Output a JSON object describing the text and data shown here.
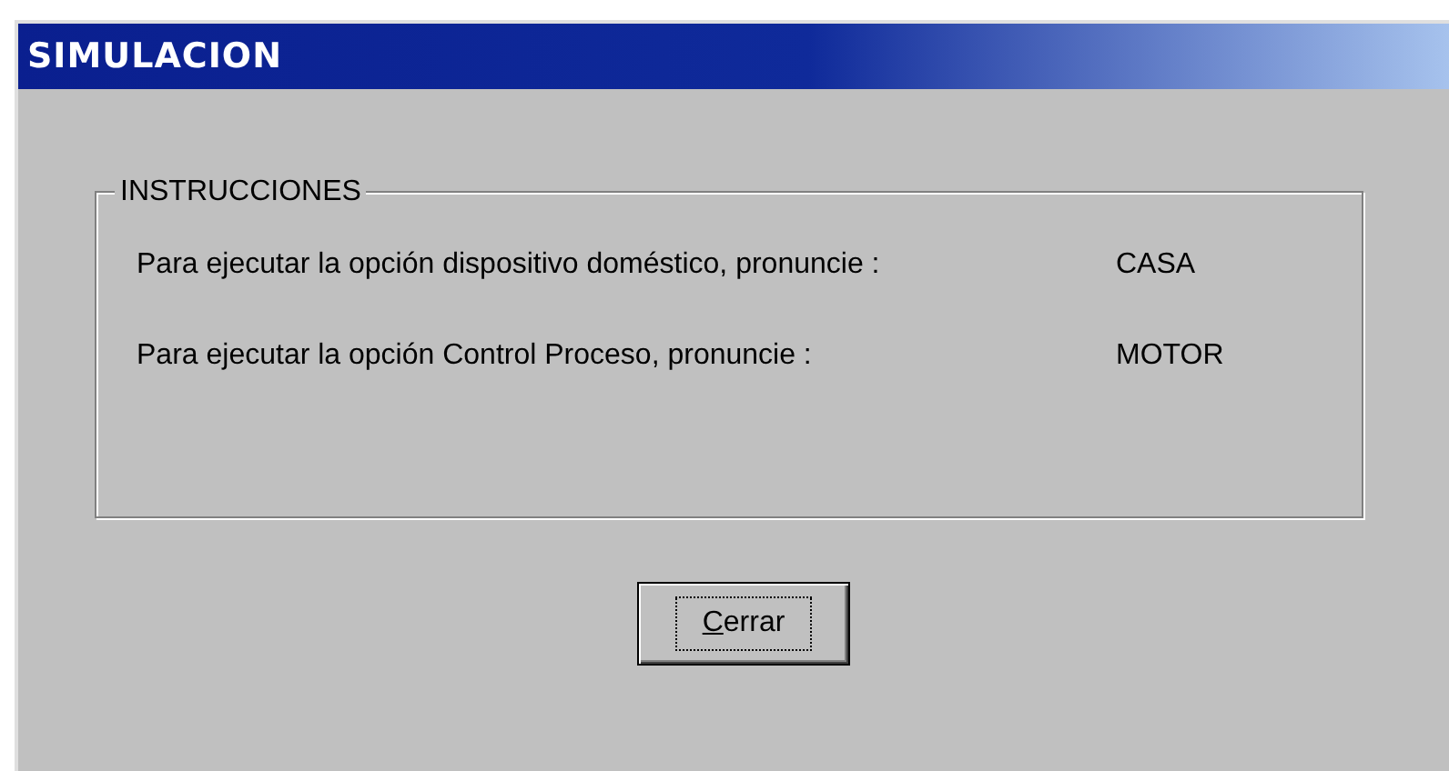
{
  "window": {
    "title": "SIMULACION"
  },
  "group": {
    "title": "INSTRUCCIONES",
    "rows": [
      {
        "text": "Para ejecutar la opción dispositivo doméstico, pronuncie :",
        "command": "CASA"
      },
      {
        "text": "Para ejecutar la opción Control Proceso, pronuncie :",
        "command": "MOTOR"
      }
    ]
  },
  "button": {
    "label": "Cerrar",
    "focused": true
  }
}
